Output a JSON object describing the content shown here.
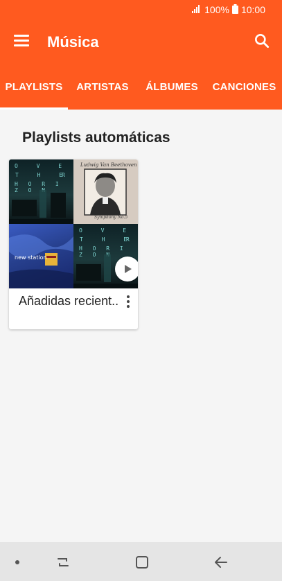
{
  "status_bar": {
    "battery": "100%",
    "time": "10:00"
  },
  "app_bar": {
    "title": "Música"
  },
  "tabs": [
    {
      "label": "PLAYLISTS",
      "active": true
    },
    {
      "label": "ARTISTAS",
      "active": false
    },
    {
      "label": "ÁLBUMES",
      "active": false
    },
    {
      "label": "CANCIONES",
      "active": false
    }
  ],
  "main": {
    "section_title": "Playlists automáticas",
    "playlists": [
      {
        "name": "Añadidas recient..",
        "cover_texts": {
          "over": "O V E",
          "the": "T H E",
          "r": "R",
          "horizon": "H O R I Z O N",
          "ludwig": "Ludwig Van Beethoven",
          "symphony": "Symphony No.5",
          "new_station": "new station"
        }
      }
    ]
  },
  "icons": {
    "menu": "hamburger-menu-icon",
    "search": "search-icon",
    "more": "more-vertical-icon",
    "play": "play-icon",
    "recent_apps": "recent-apps-icon",
    "home": "home-icon",
    "back": "back-icon"
  },
  "colors": {
    "accent": "#ff5a1f",
    "background": "#f5f5f5"
  }
}
